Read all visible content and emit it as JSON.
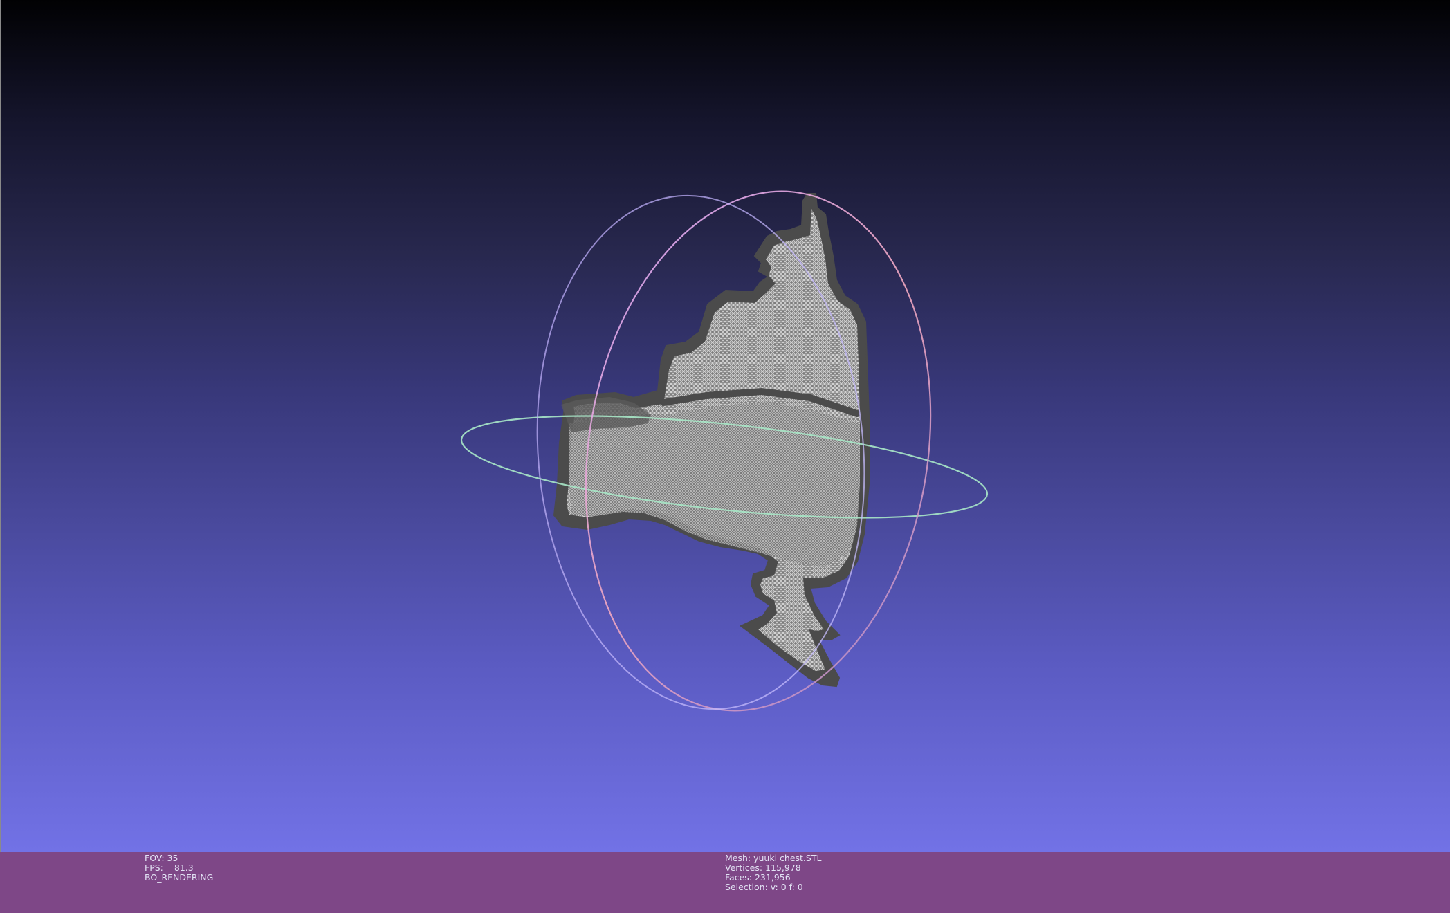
{
  "viewer": {
    "fov_label": "FOV:",
    "fov_value": "35",
    "fps_label": "FPS:",
    "fps_value": "81.3",
    "render_mode": "BO_RENDERING"
  },
  "mesh_info": {
    "mesh": "Mesh: yuuki chest.STL",
    "vertices": "Vertices: 115,978",
    "faces": "Faces: 231,956",
    "selection": "Selection: v: 0 f: 0"
  },
  "colors": {
    "background_top": "#010103",
    "background_bottom": "#7272e6",
    "info_bar": "#7e4787",
    "mesh_outline": "#4a4a4a",
    "mesh_fill": "#9a9a9a",
    "trackball_horizontal": "#a8e8c8",
    "trackball_vertical_a": "#e8a8c8",
    "trackball_vertical_b": "#c8b8f0"
  },
  "icons": {
    "trackball": "trackball-gizmo",
    "mesh": "wireframe-mesh"
  }
}
